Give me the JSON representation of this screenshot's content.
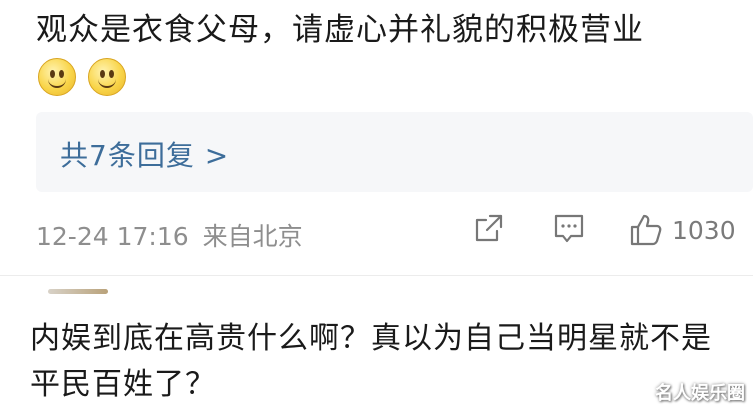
{
  "comment1": {
    "text": "观众是衣食父母，请虚心并礼貌的积极营业",
    "emojis": [
      "smile-emoji",
      "smile-emoji"
    ],
    "reply_link": "共7条回复 >",
    "time": "12-24 17:16",
    "location": "来自北京",
    "like_count": "1030"
  },
  "comment2": {
    "line1": "内娱到底在高贵什么啊？真以为自己当明星就不是",
    "line2": "平民百姓了？"
  },
  "watermark": "名人娱乐圈",
  "colors": {
    "link": "#3d6d9a",
    "meta": "#8e8e8e",
    "reply_bg": "#f6f7f9",
    "text": "#1a1a1a"
  }
}
